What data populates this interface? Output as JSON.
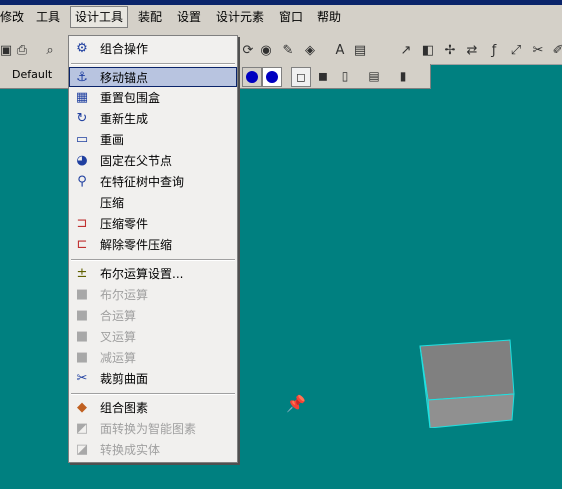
{
  "menubar": {
    "items": [
      {
        "label": "修改"
      },
      {
        "label": "工具"
      },
      {
        "label": "设计工具"
      },
      {
        "label": "装配"
      },
      {
        "label": "设置"
      },
      {
        "label": "设计元素"
      },
      {
        "label": "窗口"
      },
      {
        "label": "帮助"
      }
    ]
  },
  "toolbar2": {
    "style_value": "Default"
  },
  "design_tools_menu": {
    "items": [
      {
        "label": "组合操作",
        "icon": "combine-icon",
        "enabled": true
      },
      {
        "label": "移动锚点",
        "icon": "anchor-icon",
        "enabled": true,
        "highlighted": true
      },
      {
        "label": "重置包围盒",
        "icon": "bounding-box-icon",
        "enabled": true
      },
      {
        "label": "重新生成",
        "icon": "regenerate-icon",
        "enabled": true
      },
      {
        "label": "重画",
        "icon": "redraw-icon",
        "enabled": true
      },
      {
        "label": "固定在父节点",
        "icon": "pin-to-parent-icon",
        "enabled": true
      },
      {
        "label": "在特征树中查询",
        "icon": "tree-query-icon",
        "enabled": true
      },
      {
        "label": "压缩",
        "icon": "compress-icon",
        "enabled": true
      },
      {
        "label": "压缩零件",
        "icon": "compress-part-icon",
        "enabled": true
      },
      {
        "label": "解除零件压缩",
        "icon": "uncompress-part-icon",
        "enabled": true
      },
      {
        "label": "布尔运算设置...",
        "icon": "boolean-settings-icon",
        "enabled": true
      },
      {
        "label": "布尔运算",
        "icon": "boolean-icon",
        "enabled": false
      },
      {
        "label": "合运算",
        "icon": "union-icon",
        "enabled": false
      },
      {
        "label": "叉运算",
        "icon": "intersect-icon",
        "enabled": false
      },
      {
        "label": "减运算",
        "icon": "subtract-icon",
        "enabled": false
      },
      {
        "label": "裁剪曲面",
        "icon": "trim-surface-icon",
        "enabled": true
      },
      {
        "label": "组合图素",
        "icon": "group-elements-icon",
        "enabled": true
      },
      {
        "label": "面转换为智能图素",
        "icon": "face-to-smart-icon",
        "enabled": false
      },
      {
        "label": "转换成实体",
        "icon": "convert-solid-icon",
        "enabled": false
      }
    ]
  }
}
